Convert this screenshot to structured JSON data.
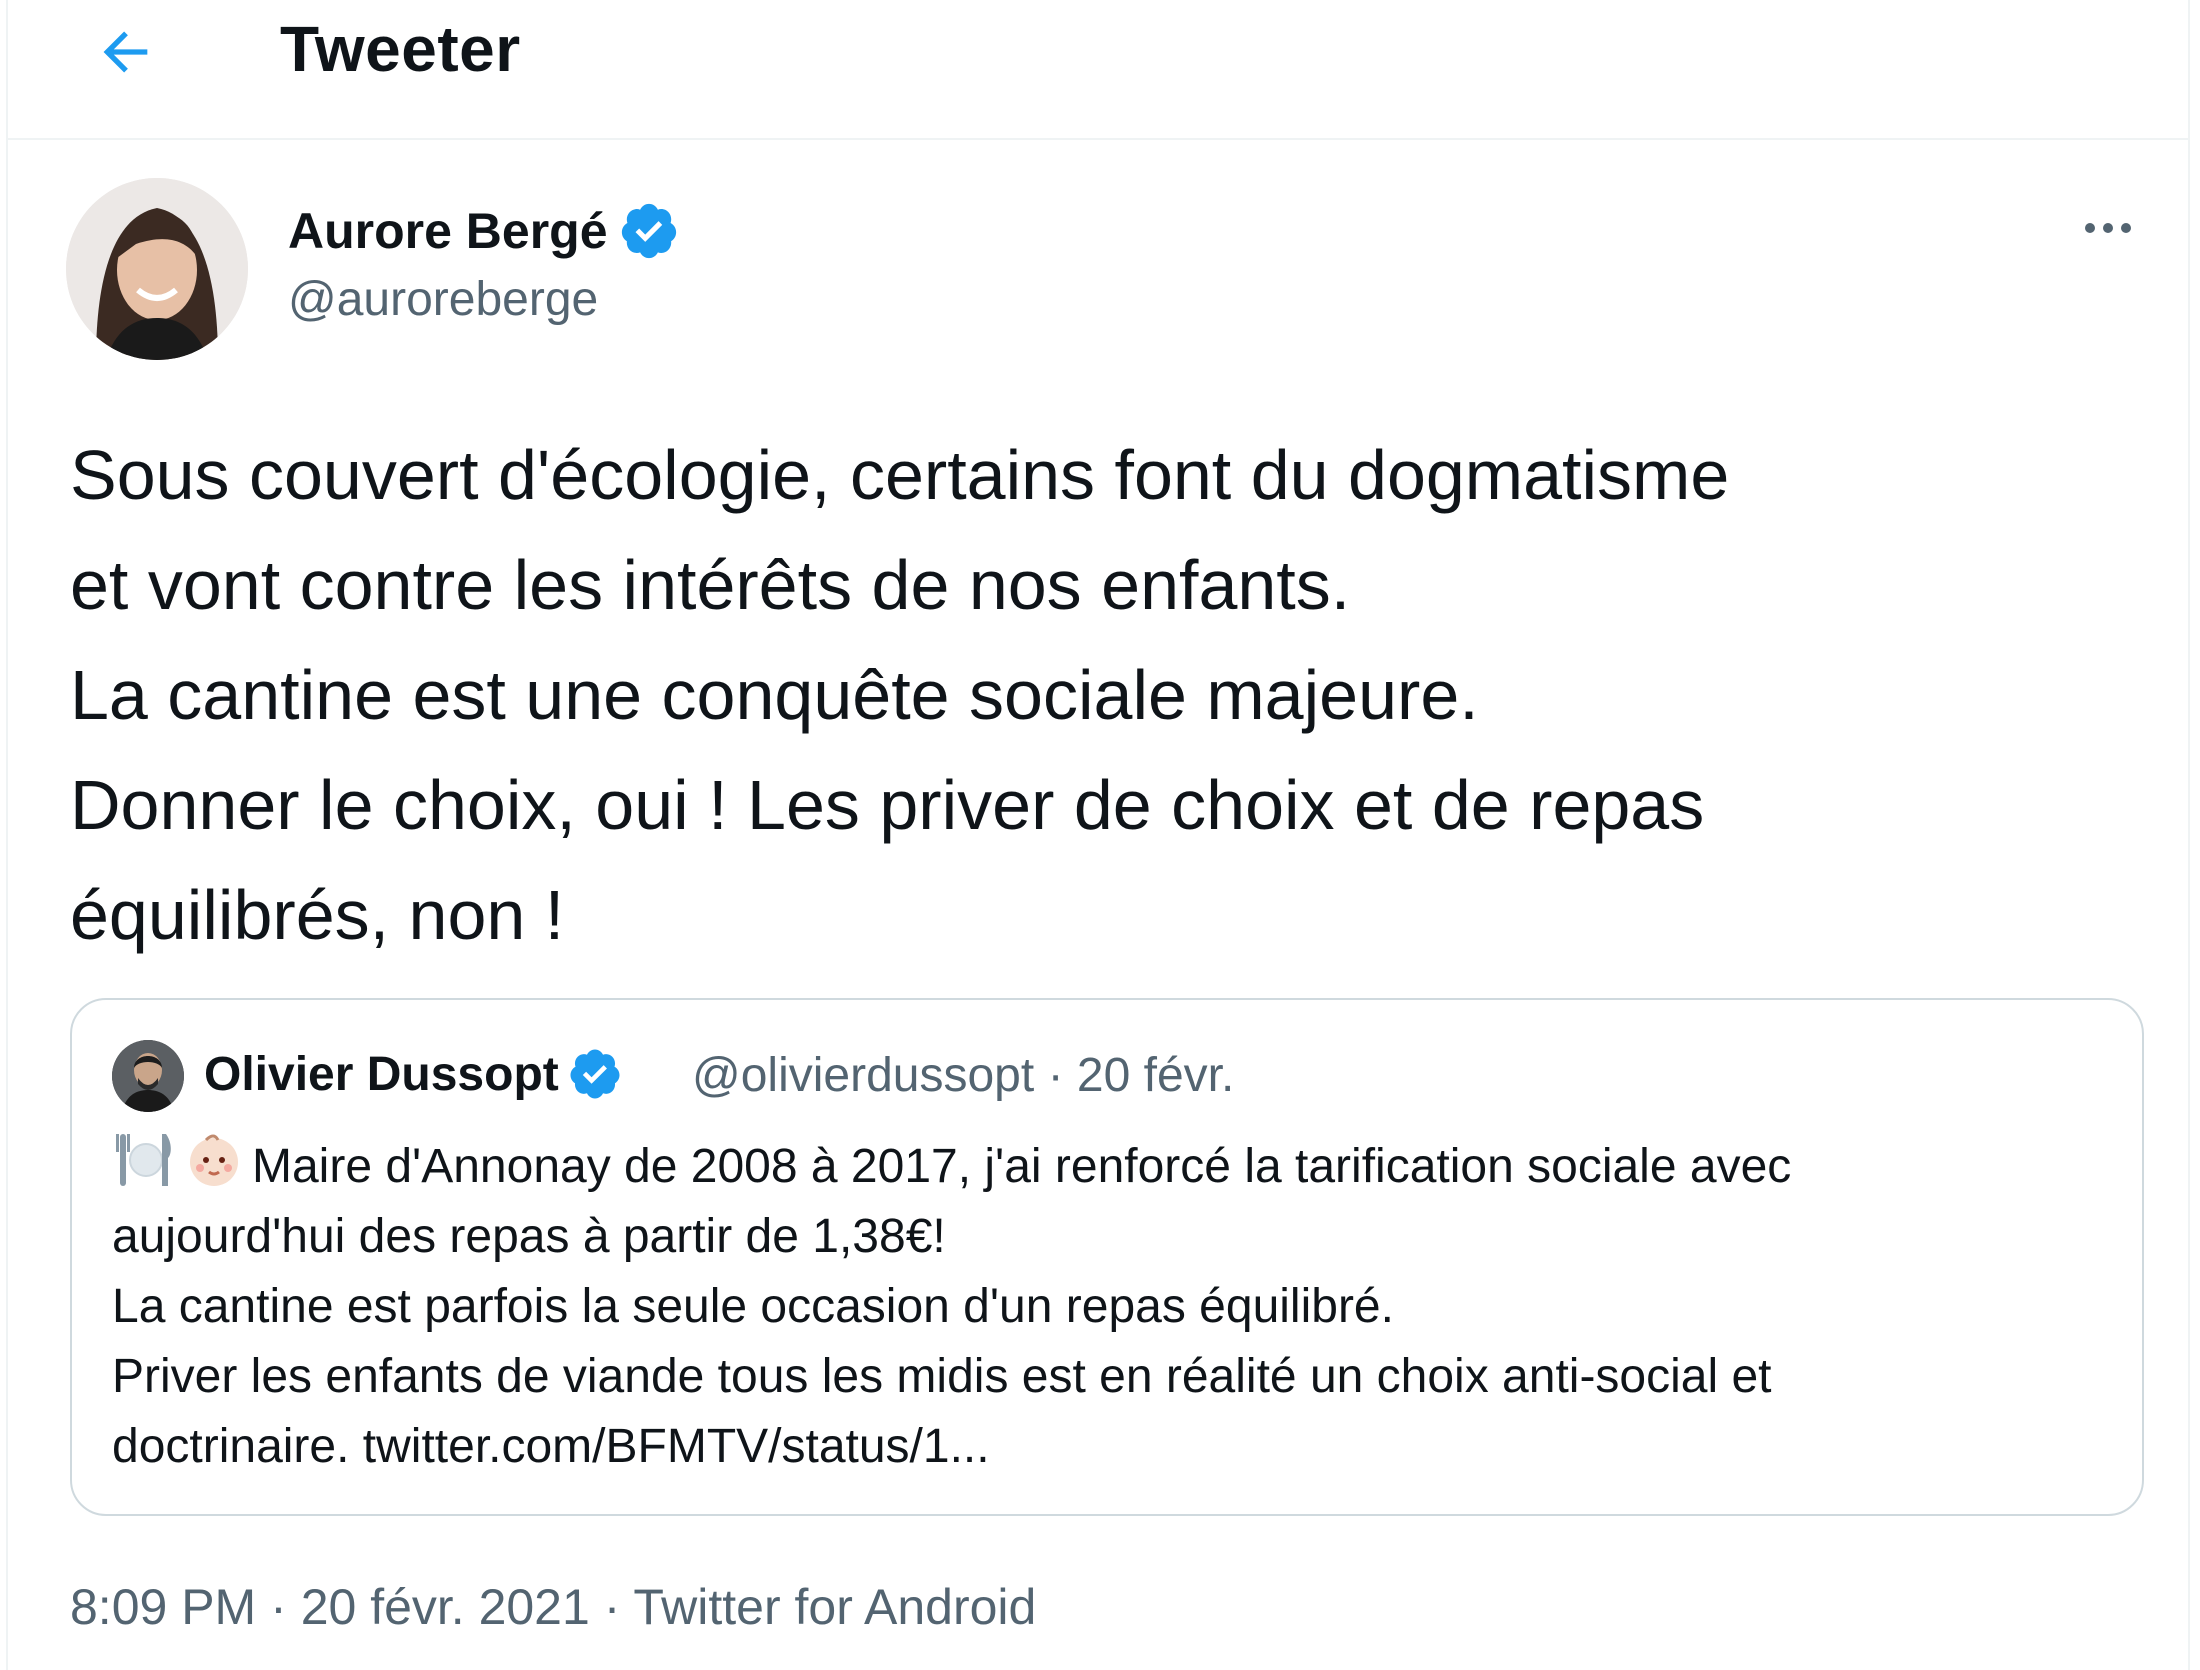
{
  "header": {
    "title": "Tweeter",
    "back_icon": "arrow-left-icon"
  },
  "colors": {
    "accent": "#1d9bf0",
    "secondary_text": "#536471",
    "border": "#cfd9de"
  },
  "tweet": {
    "author": {
      "name": "Aurore Bergé",
      "handle": "@auroreberge",
      "verified": true
    },
    "text_lines": [
      "Sous couvert d'écologie, certains font du dogmatisme",
      "et vont contre les intérêts de nos enfants.",
      "La cantine est une conquête sociale majeure.",
      "Donner le choix, oui ! Les priver de choix et de repas",
      "équilibrés, non !"
    ],
    "quoted": {
      "name": "Olivier Dussopt",
      "handle": "@olivierdussopt",
      "separator": "·",
      "date": "20 févr.",
      "emojis": [
        "fork-and-knife-plate-icon",
        "baby-face-icon"
      ],
      "text_lines": [
        "Maire d'Annonay de 2008 à 2017, j'ai renforcé la tarification sociale avec",
        "aujourd'hui des repas à partir de 1,38€!",
        "La cantine est parfois la seule occasion d'un repas équilibré.",
        "Priver les enfants de viande tous les midis est en réalité un choix anti-social et",
        "doctrinaire. twitter.com/BFMTV/status/1..."
      ]
    },
    "footer": {
      "time": "8:09 PM",
      "separator": "·",
      "date": "20 févr. 2021",
      "source": "Twitter for Android"
    }
  }
}
